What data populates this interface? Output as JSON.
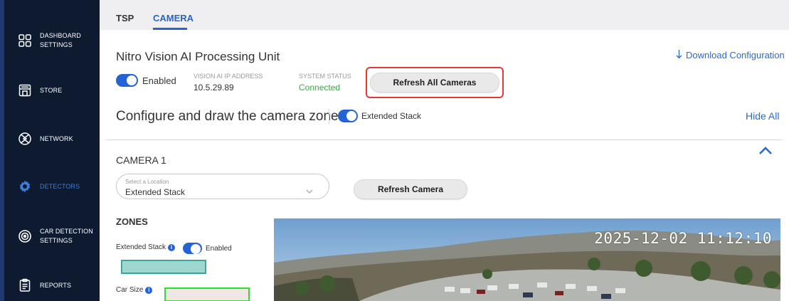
{
  "sidebar": {
    "items": [
      {
        "label": "DASHBOARD\nSETTINGS",
        "icon": "dashboard-grid-icon"
      },
      {
        "label": "STORE",
        "icon": "store-icon"
      },
      {
        "label": "NETWORK",
        "icon": "network-icon"
      },
      {
        "label": "DETECTORS",
        "icon": "gear-icon"
      },
      {
        "label": "CAR DETECTION\nSETTINGS",
        "icon": "target-icon"
      },
      {
        "label": "REPORTS",
        "icon": "clipboard-icon"
      }
    ],
    "active_item": "DETECTORS"
  },
  "tabs": [
    {
      "label": "TSP"
    },
    {
      "label": "CAMERA"
    }
  ],
  "active_tab": "CAMERA",
  "processing_unit": {
    "title": "Nitro Vision AI Processing Unit",
    "download_label": "Download Configuration",
    "enabled_label": "Enabled",
    "ip_label": "VISION AI IP ADDRESS",
    "ip_value": "10.5.29.89",
    "status_label": "SYSTEM STATUS",
    "status_value": "Connected",
    "refresh_all_label": "Refresh All Cameras"
  },
  "zones_header": {
    "title": "Configure and draw the camera zones",
    "extended_stack_label": "Extended Stack",
    "hide_all_label": "Hide All"
  },
  "camera": {
    "title": "CAMERA 1",
    "location_label": "Select a Location",
    "location_value": "Extended Stack",
    "refresh_label": "Refresh Camera",
    "zones_title": "ZONES",
    "zone_extended_stack_label": "Extended Stack",
    "zone_enabled_label": "Enabled",
    "car_size_label": "Car Size",
    "timestamp": "2025-12-02 11:12:10"
  },
  "colors": {
    "sidebar_bg": "#0e1a30",
    "accent": "#2463d6",
    "status_green": "#3ba842",
    "highlight_red": "#e03a3a",
    "zone_extended_stack": "#9fd6d0",
    "zone_car_size": "#f0e6e6"
  }
}
